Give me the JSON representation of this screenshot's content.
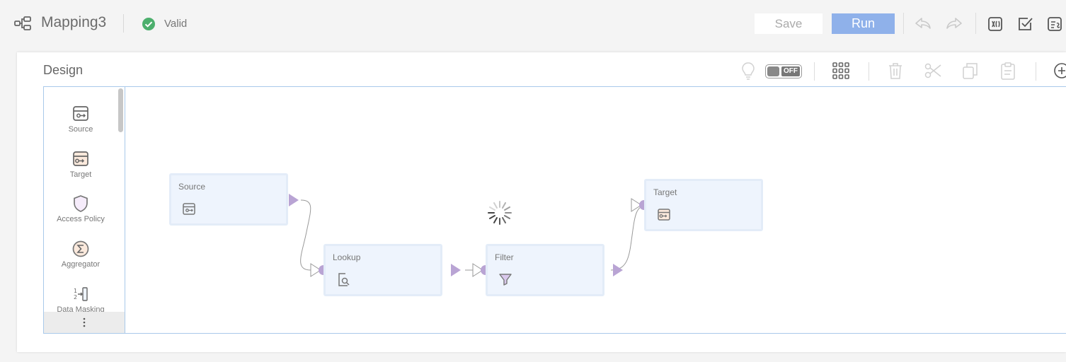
{
  "header": {
    "title": "Mapping3",
    "status": "Valid",
    "save_label": "Save",
    "run_label": "Run"
  },
  "design": {
    "label": "Design",
    "toggle_text": "OFF"
  },
  "palette": {
    "items": [
      {
        "label": "Source",
        "icon": "source-icon"
      },
      {
        "label": "Target",
        "icon": "target-icon"
      },
      {
        "label": "Access Policy",
        "icon": "shield-icon"
      },
      {
        "label": "Aggregator",
        "icon": "sigma-icon"
      },
      {
        "label": "Data Masking",
        "icon": "data-masking-icon"
      }
    ]
  },
  "nodes": [
    {
      "title": "Source",
      "icon": "source-icon"
    },
    {
      "title": "Lookup",
      "icon": "lookup-icon"
    },
    {
      "title": "Filter",
      "icon": "filter-icon"
    },
    {
      "title": "Target",
      "icon": "target-icon"
    }
  ],
  "colors": {
    "accent": "#8fb1ea",
    "valid": "#4caf6d",
    "port": "#b9a4d4",
    "node_bg": "#eef4fd"
  }
}
